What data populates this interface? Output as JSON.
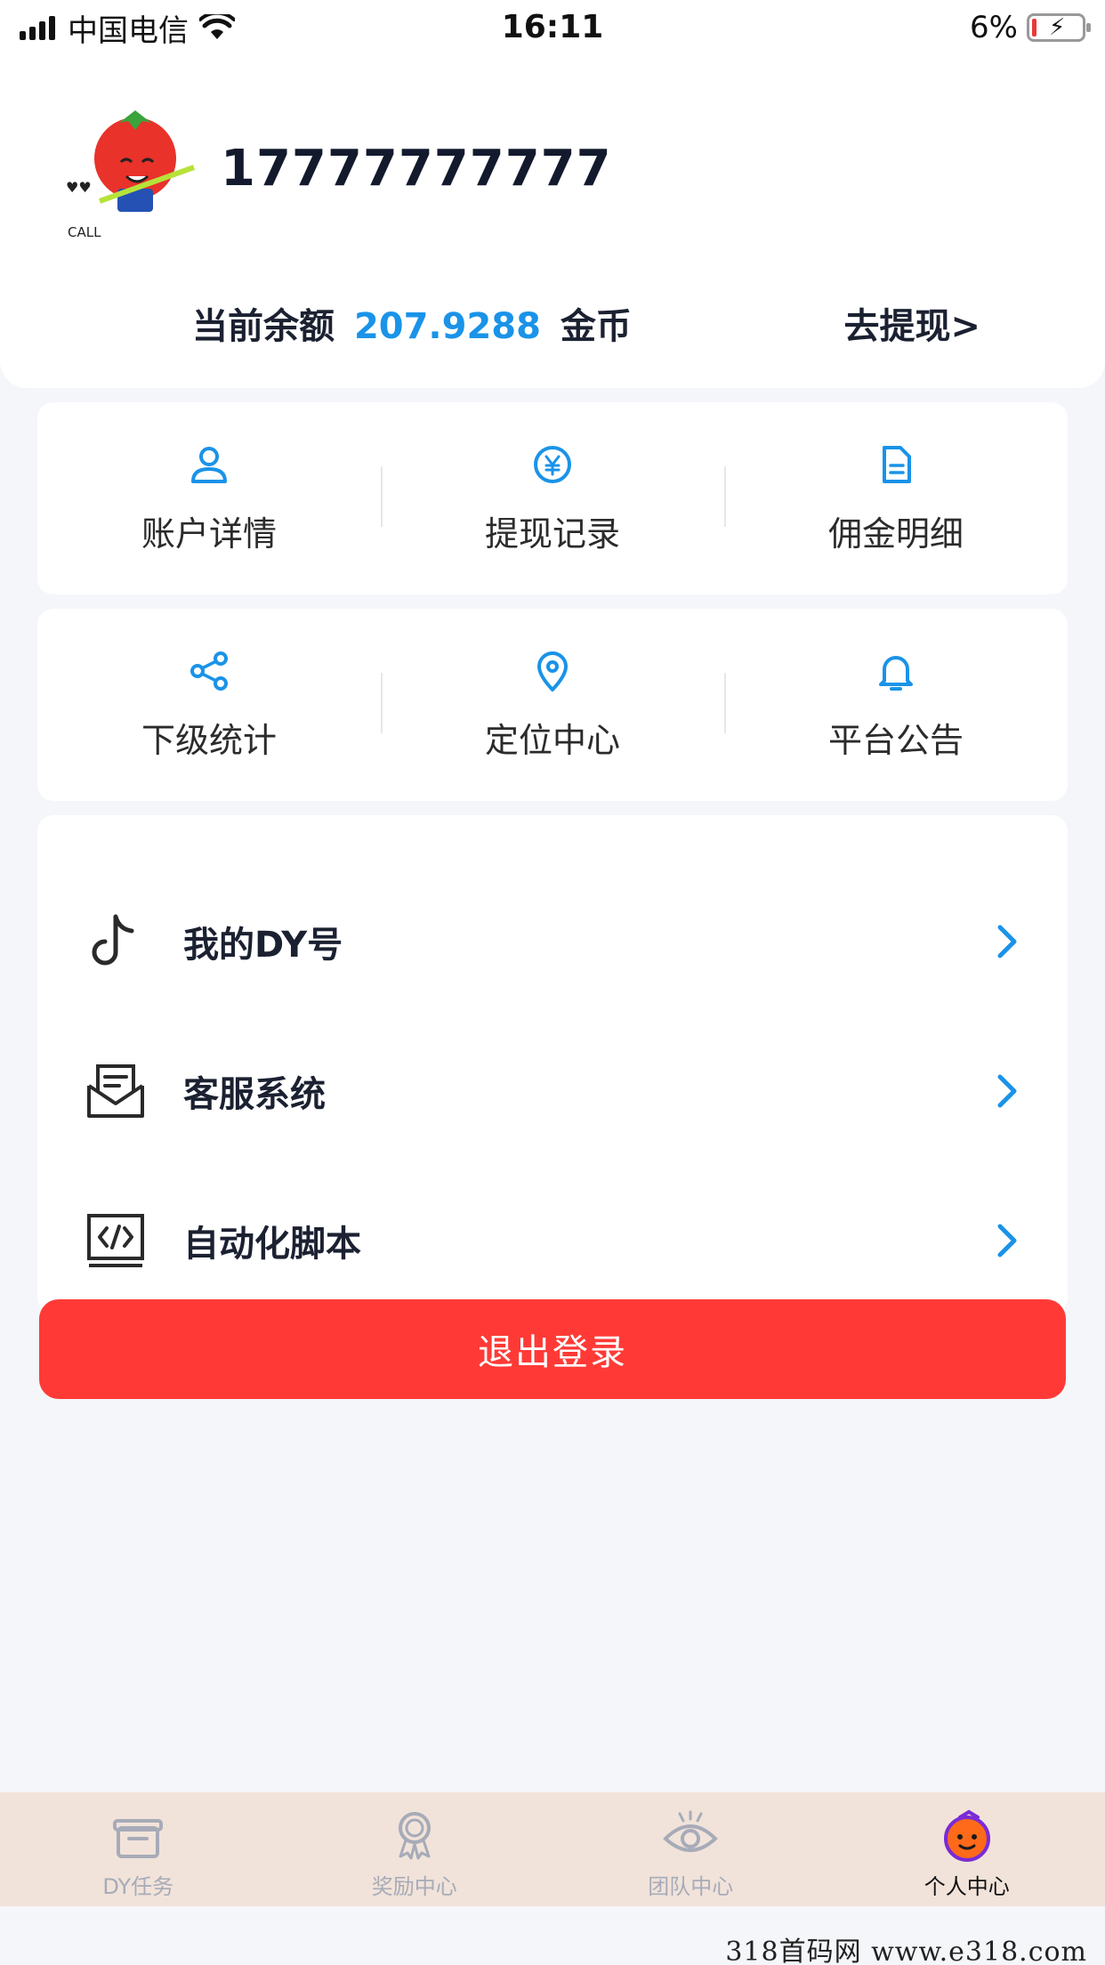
{
  "status_bar": {
    "carrier": "中国电信",
    "time": "16:11",
    "battery": "6%"
  },
  "profile": {
    "phone": "17777777777",
    "balance_label": "当前余额",
    "balance_value": "207.9288",
    "balance_unit": "金币",
    "withdraw_link": "去提现>"
  },
  "grid_row_1": [
    {
      "label": "账户详情",
      "icon": "user-icon"
    },
    {
      "label": "提现记录",
      "icon": "yen-icon"
    },
    {
      "label": "佣金明细",
      "icon": "document-icon"
    }
  ],
  "grid_row_2": [
    {
      "label": "下级统计",
      "icon": "share-icon"
    },
    {
      "label": "定位中心",
      "icon": "location-pin-icon"
    },
    {
      "label": "平台公告",
      "icon": "bell-icon"
    }
  ],
  "menu": [
    {
      "label": "我的DY号",
      "icon": "tiktok-icon"
    },
    {
      "label": "客服系统",
      "icon": "envelope-icon"
    },
    {
      "label": "自动化脚本",
      "icon": "code-icon"
    }
  ],
  "logout_label": "退出登录",
  "tabs": [
    {
      "label": "DY任务",
      "icon": "gift-box-icon"
    },
    {
      "label": "奖励中心",
      "icon": "award-icon"
    },
    {
      "label": "团队中心",
      "icon": "eye-icon"
    },
    {
      "label": "个人中心",
      "icon": "tomato-face-icon",
      "active": true
    }
  ],
  "colors": {
    "accent": "#1a93e8",
    "danger": "#ff3a36",
    "tab_bar_bg": "#f1e3da",
    "page_bg": "#f4f6fa"
  },
  "watermark": "318首码网  www.e318.com"
}
